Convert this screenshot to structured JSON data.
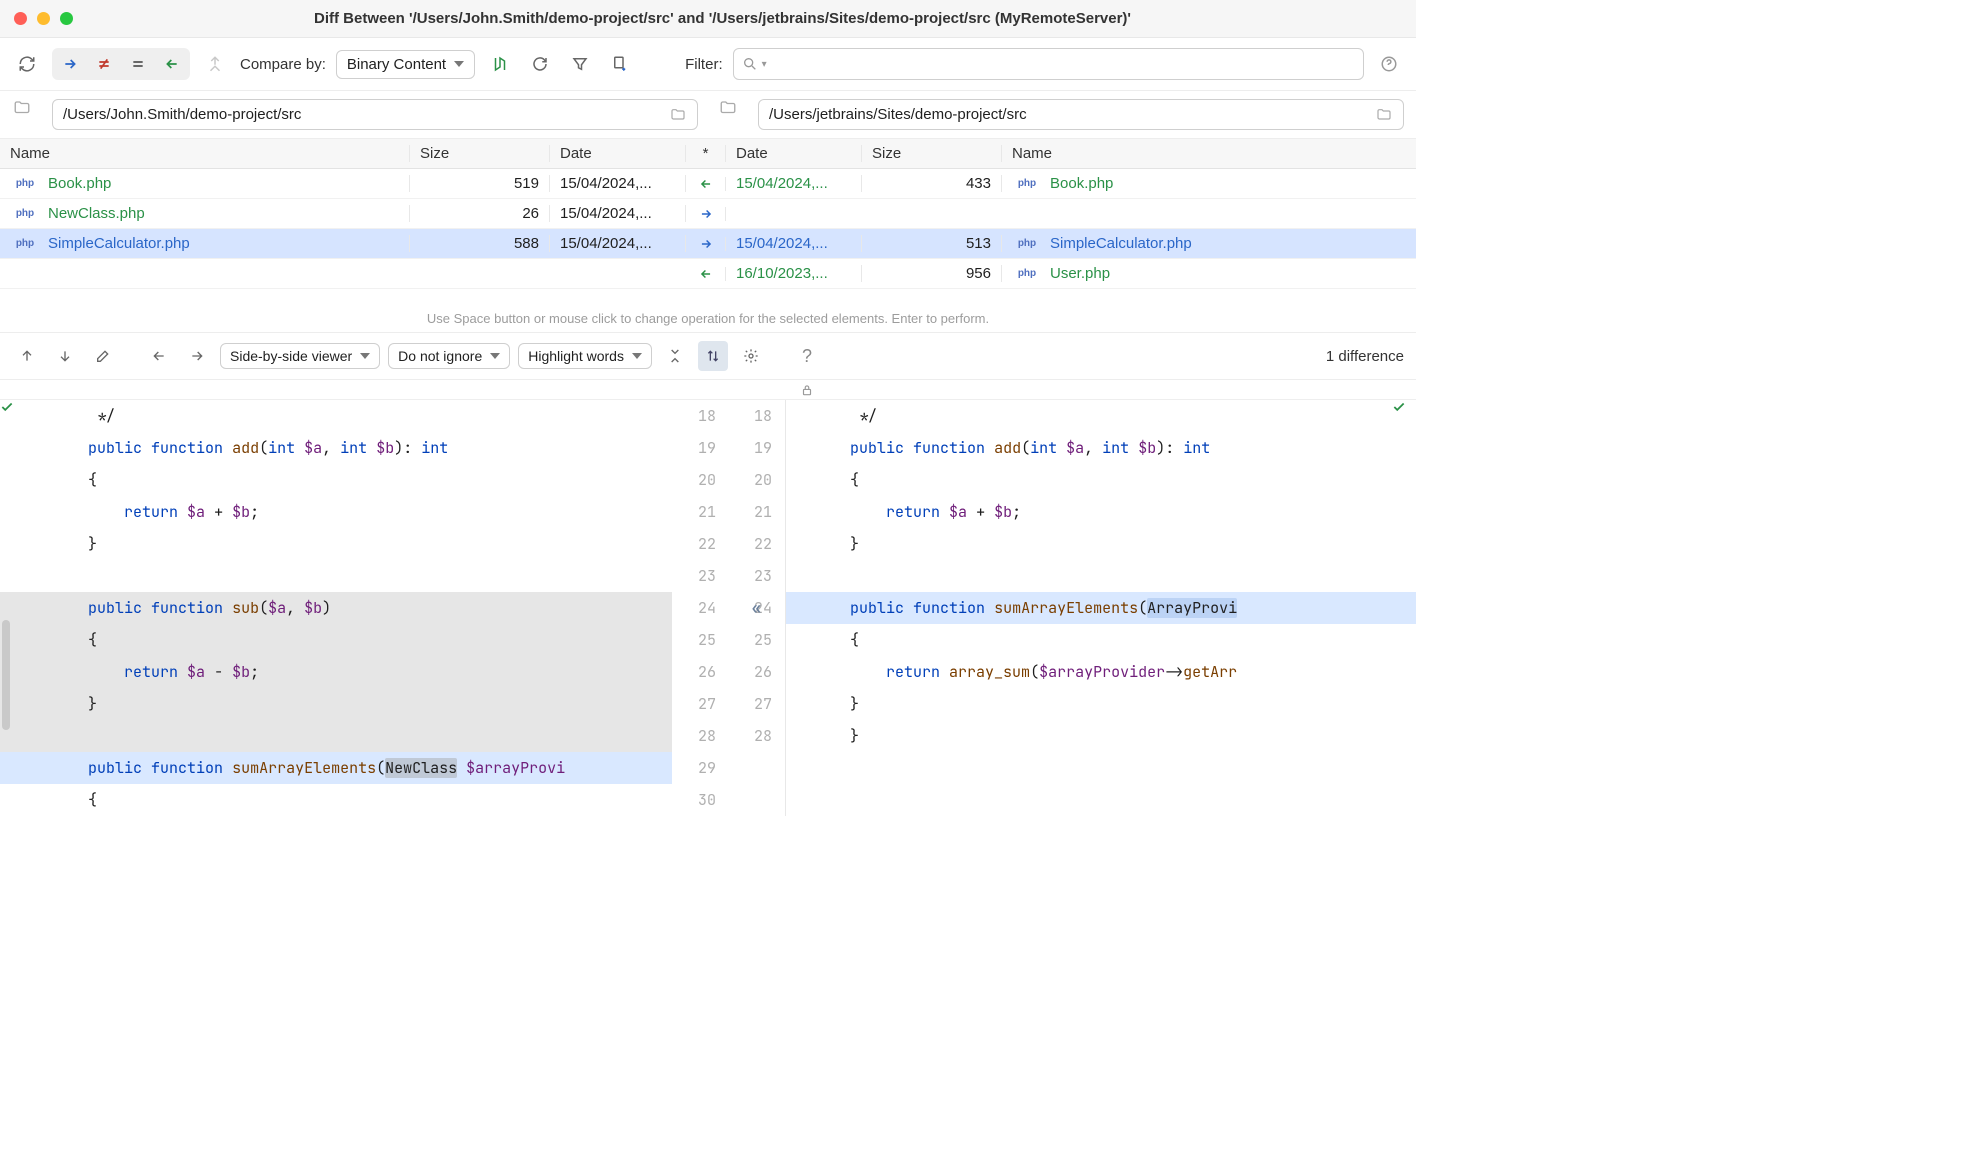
{
  "window": {
    "title": "Diff Between '/Users/John.Smith/demo-project/src' and '/Users/jetbrains/Sites/demo-project/src (MyRemoteServer)'"
  },
  "toolbar": {
    "compare_by_label": "Compare by:",
    "compare_by_value": "Binary Content",
    "filter_label": "Filter:",
    "filter_value": ""
  },
  "paths": {
    "left": "/Users/John.Smith/demo-project/src",
    "right": "/Users/jetbrains/Sites/demo-project/src"
  },
  "columns": {
    "name": "Name",
    "size": "Size",
    "date": "Date",
    "op": "*"
  },
  "files": [
    {
      "left_name": "Book.php",
      "left_size": "519",
      "left_date": "15/04/2024,...",
      "op": "left",
      "right_date": "15/04/2024,...",
      "right_size": "433",
      "right_name": "Book.php",
      "color": "green"
    },
    {
      "left_name": "NewClass.php",
      "left_size": "26",
      "left_date": "15/04/2024,...",
      "op": "right",
      "right_date": "",
      "right_size": "",
      "right_name": "",
      "color": "green"
    },
    {
      "left_name": "SimpleCalculator.php",
      "left_size": "588",
      "left_date": "15/04/2024,...",
      "op": "right",
      "right_date": "15/04/2024,...",
      "right_size": "513",
      "right_name": "SimpleCalculator.php",
      "color": "blue",
      "selected": true
    },
    {
      "left_name": "",
      "left_size": "",
      "left_date": "",
      "op": "left",
      "right_date": "16/10/2023,...",
      "right_size": "956",
      "right_name": "User.php",
      "color": "green"
    }
  ],
  "hint": "Use Space button or mouse click to change operation for the selected elements. Enter to perform.",
  "diff_toolbar": {
    "viewer_mode": "Side-by-side viewer",
    "ignore_mode": "Do not ignore",
    "highlight_mode": "Highlight words",
    "diff_count": "1 difference"
  },
  "code": {
    "left_lines": [
      {
        "n": 18,
        "html": " */"
      },
      {
        "n": 19,
        "html": "<span class='kw'>public</span> <span class='kw'>function</span> <span class='fn'>add</span>(<span class='type'>int</span> <span class='var'>$a</span>, <span class='type'>int</span> <span class='var'>$b</span>): <span class='type'>int</span>"
      },
      {
        "n": 20,
        "html": "{"
      },
      {
        "n": 21,
        "html": "    <span class='kw'>return</span> <span class='var'>$a</span> + <span class='var'>$b</span>;"
      },
      {
        "n": 22,
        "html": "}"
      },
      {
        "n": 23,
        "html": ""
      },
      {
        "n": 24,
        "html": "<span class='kw'>public</span> <span class='kw'>function</span> <span class='fn'>sub</span>(<span class='var'>$a</span>, <span class='var'>$b</span>)",
        "cls": "hl-old"
      },
      {
        "n": 25,
        "html": "{",
        "cls": "hl-old"
      },
      {
        "n": 26,
        "html": "    <span class='kw'>return</span> <span class='var'>$a</span> - <span class='var'>$b</span>;",
        "cls": "hl-old"
      },
      {
        "n": 27,
        "html": "}",
        "cls": "hl-old"
      },
      {
        "n": 28,
        "html": "",
        "cls": "hl-old"
      },
      {
        "n": 29,
        "html": "<span class='kw'>public</span> <span class='kw'>function</span> <span class='fn'>sumArrayElements</span>(<span class='hl-word'>NewClass</span> <span class='var'>$arrayProvi</span>",
        "cls": "hl-new"
      },
      {
        "n": 30,
        "html": "{"
      }
    ],
    "right_lines": [
      {
        "n": 18,
        "html": " */"
      },
      {
        "n": 19,
        "html": "<span class='kw'>public</span> <span class='kw'>function</span> <span class='fn'>add</span>(<span class='type'>int</span> <span class='var'>$a</span>, <span class='type'>int</span> <span class='var'>$b</span>): <span class='type'>int</span>"
      },
      {
        "n": 20,
        "html": "{"
      },
      {
        "n": 21,
        "html": "    <span class='kw'>return</span> <span class='var'>$a</span> + <span class='var'>$b</span>;"
      },
      {
        "n": 22,
        "html": "}"
      },
      {
        "n": 23,
        "html": ""
      },
      {
        "n": 24,
        "html": "<span class='kw'>public</span> <span class='kw'>function</span> <span class='fn'>sumArrayElements</span>(<span class='hl-word2'>ArrayProvi</span>",
        "cls": "hl-new"
      },
      {
        "n": 25,
        "html": "{"
      },
      {
        "n": 26,
        "html": "    <span class='kw'>return</span> <span class='fn'>array_sum</span>(<span class='var'>$arrayProvider</span>-&gt;<span class='fn'>getArr</span>"
      },
      {
        "n": 27,
        "html": "}"
      },
      {
        "n": 28,
        "html": "}"
      }
    ]
  }
}
